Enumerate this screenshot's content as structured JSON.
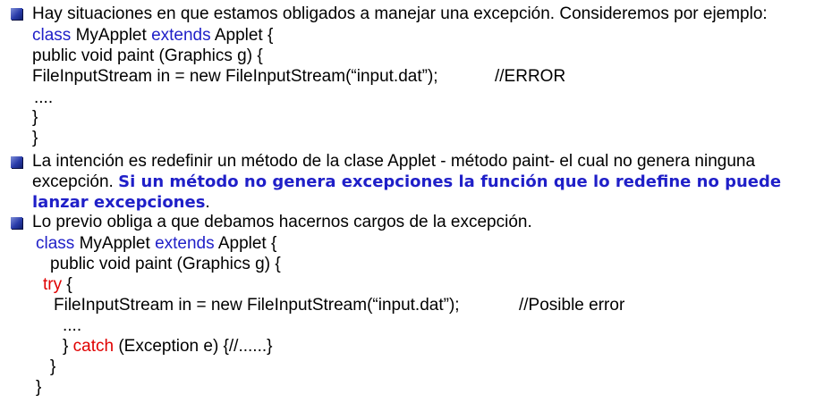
{
  "bullets": [
    {
      "text": "Hay situaciones en que estamos obligados a manejar una excepción. Consideremos por ejemplo:"
    },
    {
      "text_part1": "La intención es redefinir un método de la clase Applet - método paint- el cual no genera ninguna",
      "text_part2": "excepción. ",
      "emphasis_line1": "Si un método no genera excepciones la función que lo redefine no puede",
      "emphasis_line2": "lanzar excepciones",
      "period": "."
    },
    {
      "text": "Lo previo obliga a que debamos hacernos cargos de la excepción."
    }
  ],
  "code1": {
    "l1_kw1": "class",
    "l1_name": " MyApplet ",
    "l1_kw2": "extends",
    "l1_rest": " Applet {",
    "l2": "public void paint (Graphics g) {",
    "l3_code": "FileInputStream in = new FileInputStream(“input.dat”);",
    "l3_comment": "//ERROR",
    "l4": "....",
    "l5": "}",
    "l6": "}"
  },
  "code2": {
    "l1_kw1": "class",
    "l1_name": " MyApplet ",
    "l1_kw2": "extends",
    "l1_rest": " Applet {",
    "l2": "public void paint (Graphics g) {",
    "l3_kw": "try",
    "l3_rest": " {",
    "l4_code": "FileInputStream in = new FileInputStream(“input.dat”);",
    "l4_comment": "//Posible error",
    "l5": "....",
    "l6_pre": "} ",
    "l6_kw": "catch",
    "l6_rest": " (Exception e) {//......}",
    "l7": "}",
    "l8": "}"
  },
  "colors": {
    "keyword_blue": "#1f1fc8",
    "keyword_red": "#e00000",
    "bullet": "#2a3caa"
  }
}
